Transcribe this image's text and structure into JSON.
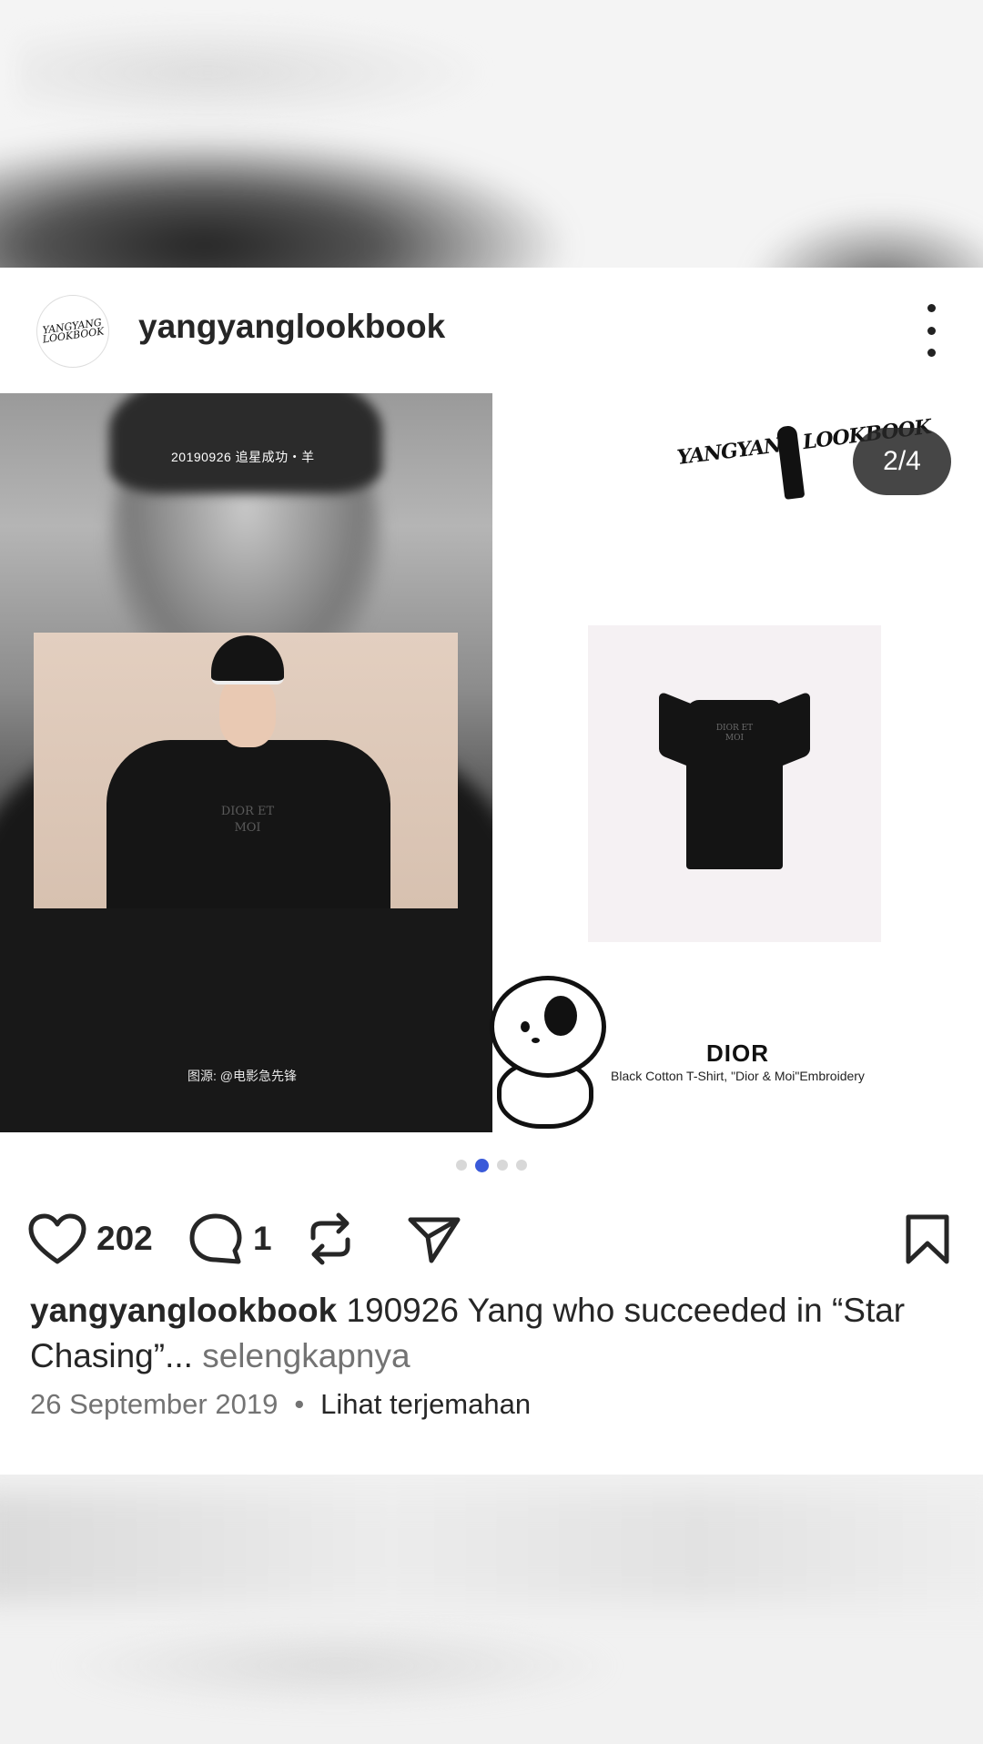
{
  "post": {
    "username": "yangyanglookbook",
    "avatar_logo_text": "YANGYANG LOOKBOOK",
    "menu_icon": "more-vertical-icon",
    "media": {
      "counter": "2/4",
      "current_index": 2,
      "total": 4,
      "left_image": {
        "date_overlay": "20190926 追星成功・羊",
        "source_overlay": "图源: @电影急先锋",
        "shirt_text": "DIOR ET MOI"
      },
      "right_image": {
        "logo_text": "YANGYANG LOOKBOOK",
        "shirt_text": "DIOR ET MOI",
        "brand": "DIOR",
        "product_description": "Black Cotton T-Shirt, \"Dior & Moi\"Embroidery"
      }
    },
    "actions": {
      "like_icon": "heart-icon",
      "like_count": "202",
      "comment_icon": "comment-icon",
      "comment_count": "1",
      "repost_icon": "repost-icon",
      "share_icon": "send-icon",
      "save_icon": "bookmark-icon"
    },
    "caption": {
      "username": "yangyanglookbook",
      "text": "190926 Yang who succeeded in “Star Chasing”",
      "ellipsis": "...",
      "more_label": "selengkapnya"
    },
    "date": "26 September 2019",
    "separator": "•",
    "translate_label": "Lihat terjemahan"
  },
  "colors": {
    "accent_dot": "#3a5ad9",
    "text_primary": "#262626",
    "text_secondary": "#737373"
  }
}
